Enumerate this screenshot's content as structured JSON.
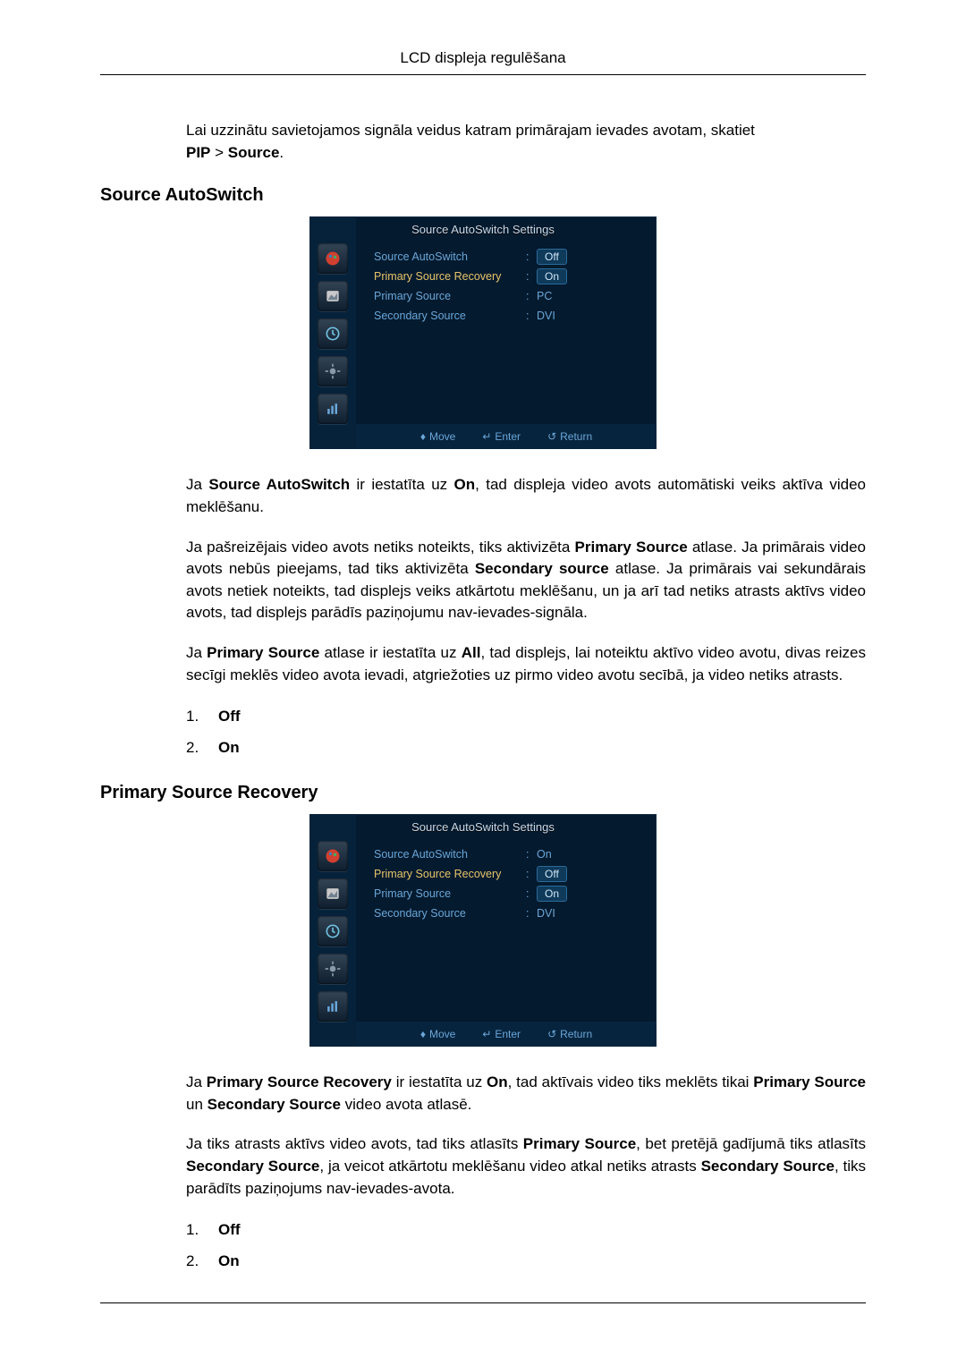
{
  "header": "LCD displeja regulēšana",
  "intro": {
    "line1": "Lai uzzinātu savietojamos signāla veidus katram primārajam ievades avotam, skatiet",
    "line2_prefix": "PIP",
    "line2_gt": " > ",
    "line2_suffix": "Source",
    "line2_end": "."
  },
  "section1": {
    "title": "Source AutoSwitch",
    "osd": {
      "title": "Source AutoSwitch Settings",
      "rows": [
        {
          "label": "Source AutoSwitch",
          "value": "Off",
          "pill": true,
          "selected": false
        },
        {
          "label": "Primary Source Recovery",
          "value": "On",
          "pill": true,
          "selected": true
        },
        {
          "label": "Primary Source",
          "value": "PC",
          "pill": false,
          "selected": false
        },
        {
          "label": "Secondary Source",
          "value": "DVI",
          "pill": false,
          "selected": false
        }
      ],
      "footer": {
        "move": "Move",
        "enter": "Enter",
        "return": "Return"
      }
    },
    "p1_a": "Ja ",
    "p1_b": "Source AutoSwitch",
    "p1_c": " ir iestatīta uz ",
    "p1_d": "On",
    "p1_e": ", tad displeja video avots automātiski veiks aktīva video meklēšanu.",
    "p2_a": "Ja pašreizējais video avots netiks noteikts, tiks aktivizēta ",
    "p2_b": "Primary Source",
    "p2_c": " atlase. Ja primārais video avots nebūs pieejams, tad tiks aktivizēta ",
    "p2_d": "Secondary source",
    "p2_e": " atlase. Ja primārais vai sekundārais avots netiek noteikts, tad displejs veiks atkārtotu meklēšanu, un ja arī tad netiks atrasts aktīvs video avots, tad displejs parādīs paziņojumu nav-ievades-signāla.",
    "p3_a": "Ja ",
    "p3_b": "Primary Source",
    "p3_c": " atlase ir iestatīta uz ",
    "p3_d": "All",
    "p3_e": ", tad displejs, lai noteiktu aktīvo video avotu, divas reizes secīgi meklēs video avota ievadi, atgriežoties uz pirmo video avotu secībā, ja video netiks atrasts.",
    "opts": [
      {
        "num": "1.",
        "val": "Off"
      },
      {
        "num": "2.",
        "val": "On"
      }
    ]
  },
  "section2": {
    "title": "Primary Source Recovery",
    "osd": {
      "title": "Source AutoSwitch Settings",
      "rows": [
        {
          "label": "Source AutoSwitch",
          "value": "On",
          "pill": false,
          "selected": false
        },
        {
          "label": "Primary Source Recovery",
          "value": "Off",
          "pill": true,
          "selected": true
        },
        {
          "label": "Primary Source",
          "value": "On",
          "pill": true,
          "selected": false
        },
        {
          "label": "Secondary Source",
          "value": "DVI",
          "pill": false,
          "selected": false
        }
      ],
      "footer": {
        "move": "Move",
        "enter": "Enter",
        "return": "Return"
      }
    },
    "p1_a": "Ja ",
    "p1_b": "Primary Source Recovery",
    "p1_c": " ir iestatīta uz ",
    "p1_d": "On",
    "p1_e": ", tad aktīvais video tiks meklēts tikai ",
    "p1_f": "Primary Source",
    "p1_g": " un ",
    "p1_h": "Secondary Source",
    "p1_i": " video avota atlasē.",
    "p2_a": "Ja tiks atrasts aktīvs video avots, tad tiks atlasīts ",
    "p2_b": "Primary Source",
    "p2_c": ", bet pretējā gadījumā tiks atlasīts ",
    "p2_d": "Secondary Source",
    "p2_e": ", ja veicot atkārtotu meklēšanu video atkal netiks atrasts ",
    "p2_f": "Secondary Source",
    "p2_g": ", tiks parādīts paziņojums nav-ievades-avota.",
    "opts": [
      {
        "num": "1.",
        "val": "Off"
      },
      {
        "num": "2.",
        "val": "On"
      }
    ]
  }
}
